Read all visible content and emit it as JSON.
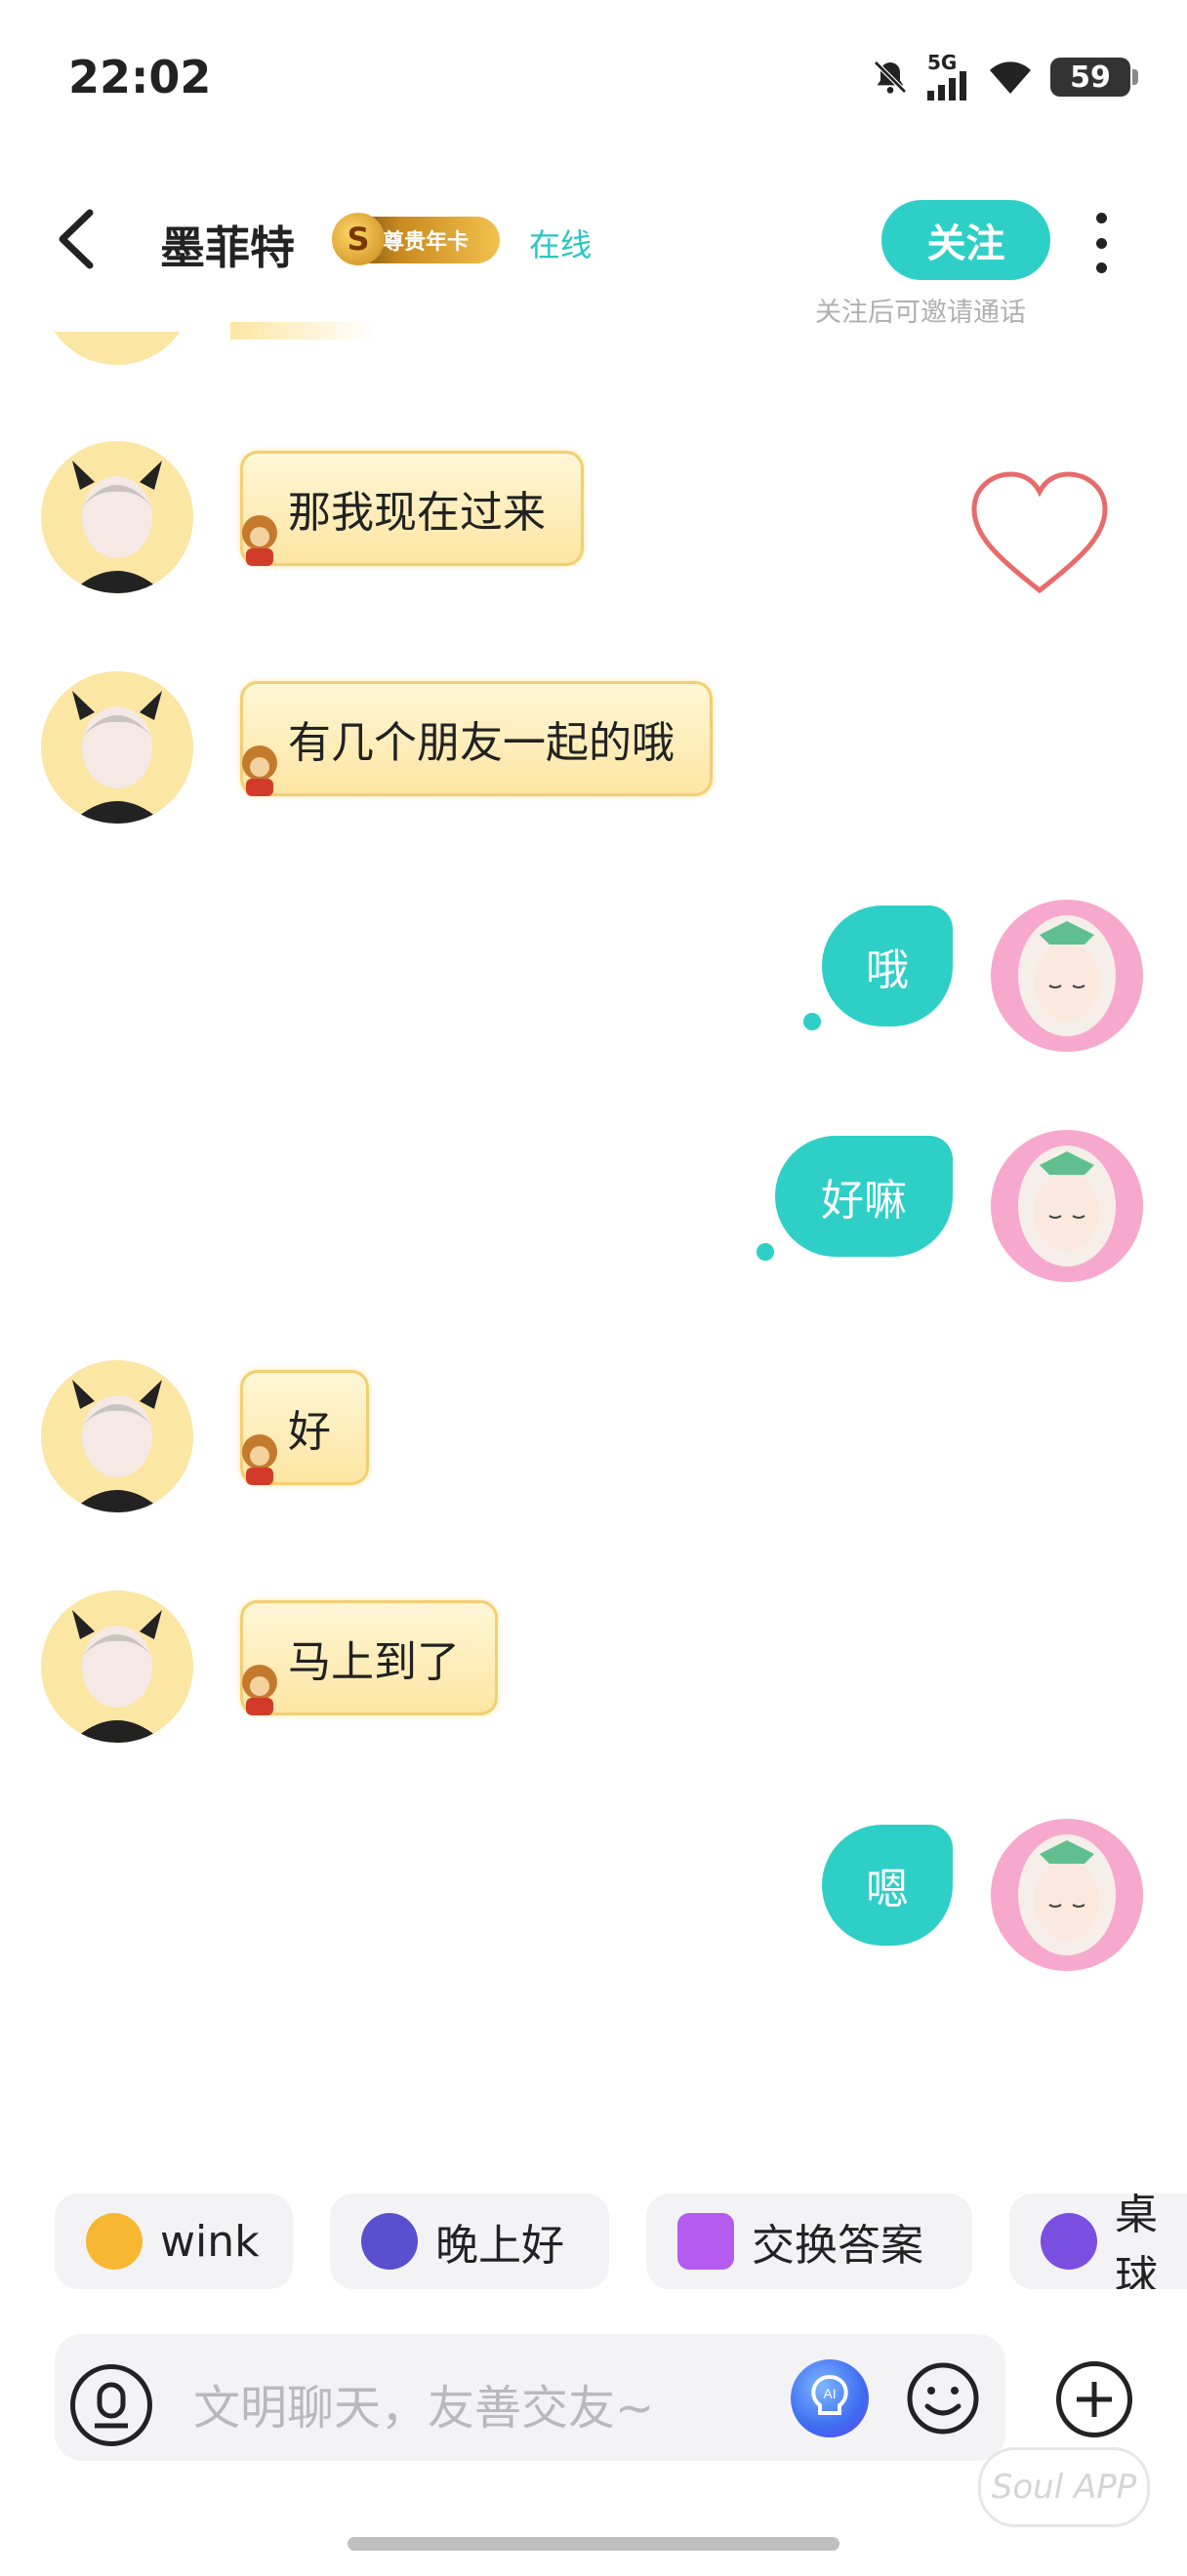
{
  "status_bar": {
    "time": "22:02",
    "network": "5G",
    "battery": "59",
    "icons": [
      "bell-off-icon",
      "signal-icon",
      "wifi-icon",
      "battery-icon"
    ]
  },
  "header": {
    "contact_name": "墨菲特",
    "badge": "尊贵年卡",
    "badge_coin": "S",
    "status": "在线",
    "follow_label": "关注",
    "follow_hint": "关注后可邀请通话"
  },
  "messages": [
    {
      "side": "left",
      "text": "那我现在过来"
    },
    {
      "side": "left",
      "text": "有几个朋友一起的哦"
    },
    {
      "side": "right",
      "text": "哦"
    },
    {
      "side": "right",
      "text": "好嘛"
    },
    {
      "side": "left",
      "text": "好"
    },
    {
      "side": "left",
      "text": "马上到了"
    },
    {
      "side": "right",
      "text": "嗯"
    }
  ],
  "quick_replies": [
    {
      "label": "wink",
      "icon": "wink-emoji-icon",
      "color": "#f7b733"
    },
    {
      "label": "晚上好",
      "icon": "moon-face-icon",
      "color": "#5a4fcf"
    },
    {
      "label": "交换答案",
      "icon": "swap-chat-icon",
      "color": "#b45cf0"
    },
    {
      "label": "桌球",
      "icon": "billiard-ball-icon",
      "color": "#7b4fe0"
    }
  ],
  "input": {
    "placeholder": "文明聊天，友善交友~"
  },
  "watermark": "Soul APP",
  "colors": {
    "accent": "#2ecfc6",
    "bubble_left": "#fde6a3",
    "heart": "#e86b6b"
  }
}
